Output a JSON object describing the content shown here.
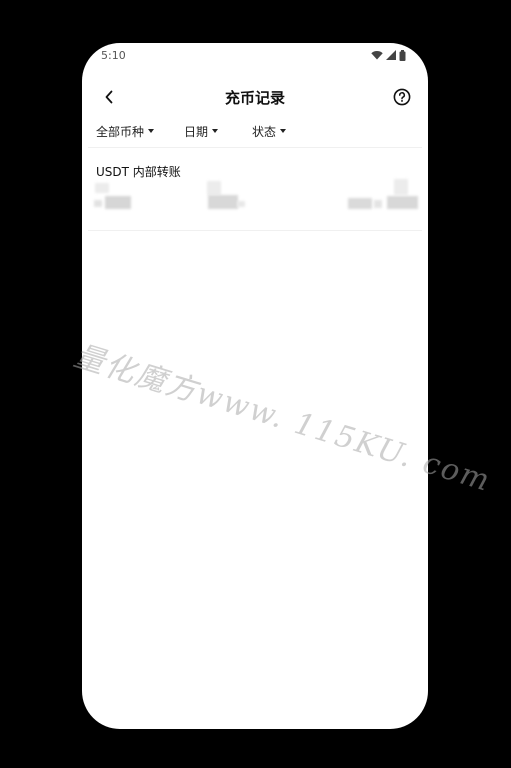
{
  "status_bar": {
    "time": "5:10"
  },
  "header": {
    "title": "充币记录"
  },
  "filters": [
    {
      "label": "全部币种"
    },
    {
      "label": "日期"
    },
    {
      "label": "状态"
    }
  ],
  "records": [
    {
      "title": "USDT 内部转账"
    }
  ],
  "watermark": {
    "text": "量化魔方www. 115KU. com"
  }
}
